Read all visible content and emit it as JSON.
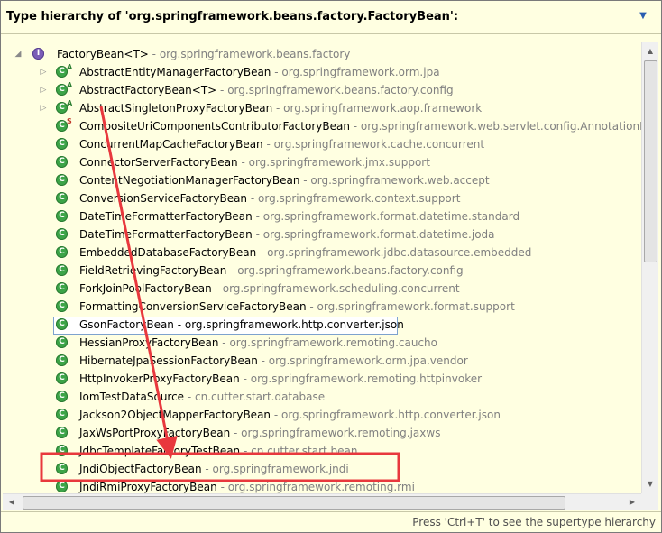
{
  "header": {
    "title": "Type hierarchy of 'org.springframework.beans.factory.FactoryBean':",
    "menu_icon": "view-menu-icon"
  },
  "tree": {
    "root": {
      "name": "FactoryBean<T>",
      "package": " - org.springframework.beans.factory",
      "icon": "interface-icon"
    },
    "items": [
      {
        "name": "AbstractEntityManagerFactoryBean",
        "package": " - org.springframework.orm.jpa",
        "expandable": true,
        "overlay": "A"
      },
      {
        "name": "AbstractFactoryBean<T>",
        "package": " - org.springframework.beans.factory.config",
        "expandable": true,
        "overlay": "A"
      },
      {
        "name": "AbstractSingletonProxyFactoryBean",
        "package": " - org.springframework.aop.framework",
        "expandable": true,
        "overlay": "A"
      },
      {
        "name": "CompositeUriComponentsContributorFactoryBean",
        "package": " - org.springframework.web.servlet.config.AnnotationDriv",
        "expandable": false,
        "overlay": "S"
      },
      {
        "name": "ConcurrentMapCacheFactoryBean",
        "package": " - org.springframework.cache.concurrent",
        "expandable": false,
        "overlay": ""
      },
      {
        "name": "ConnectorServerFactoryBean",
        "package": " - org.springframework.jmx.support",
        "expandable": false,
        "overlay": ""
      },
      {
        "name": "ContentNegotiationManagerFactoryBean",
        "package": " - org.springframework.web.accept",
        "expandable": false,
        "overlay": ""
      },
      {
        "name": "ConversionServiceFactoryBean",
        "package": " - org.springframework.context.support",
        "expandable": false,
        "overlay": ""
      },
      {
        "name": "DateTimeFormatterFactoryBean",
        "package": " - org.springframework.format.datetime.standard",
        "expandable": false,
        "overlay": ""
      },
      {
        "name": "DateTimeFormatterFactoryBean",
        "package": " - org.springframework.format.datetime.joda",
        "expandable": false,
        "overlay": ""
      },
      {
        "name": "EmbeddedDatabaseFactoryBean",
        "package": " - org.springframework.jdbc.datasource.embedded",
        "expandable": false,
        "overlay": ""
      },
      {
        "name": "FieldRetrievingFactoryBean",
        "package": " - org.springframework.beans.factory.config",
        "expandable": false,
        "overlay": ""
      },
      {
        "name": "ForkJoinPoolFactoryBean",
        "package": " - org.springframework.scheduling.concurrent",
        "expandable": false,
        "overlay": ""
      },
      {
        "name": "FormattingConversionServiceFactoryBean",
        "package": " - org.springframework.format.support",
        "expandable": false,
        "overlay": ""
      },
      {
        "name": "GsonFactoryBean",
        "package": " - org.springframework.http.converter.json",
        "expandable": false,
        "overlay": "",
        "selected": true
      },
      {
        "name": "HessianProxyFactoryBean",
        "package": " - org.springframework.remoting.caucho",
        "expandable": false,
        "overlay": ""
      },
      {
        "name": "HibernateJpaSessionFactoryBean",
        "package": " - org.springframework.orm.jpa.vendor",
        "expandable": false,
        "overlay": ""
      },
      {
        "name": "HttpInvokerProxyFactoryBean",
        "package": " - org.springframework.remoting.httpinvoker",
        "expandable": false,
        "overlay": ""
      },
      {
        "name": "IomTestDataSource",
        "package": " - cn.cutter.start.database",
        "expandable": false,
        "overlay": ""
      },
      {
        "name": "Jackson2ObjectMapperFactoryBean",
        "package": " - org.springframework.http.converter.json",
        "expandable": false,
        "overlay": ""
      },
      {
        "name": "JaxWsPortProxyFactoryBean",
        "package": " - org.springframework.remoting.jaxws",
        "expandable": false,
        "overlay": ""
      },
      {
        "name": "JdbcTemplateFactoryTestBean",
        "package": " - cn.cutter.start.bean",
        "expandable": false,
        "overlay": ""
      },
      {
        "name": "JndiObjectFactoryBean",
        "package": " - org.springframework.jndi",
        "expandable": false,
        "overlay": "",
        "highlighted": true
      },
      {
        "name": "JndiRmiProxyFactoryBean",
        "package": " - org.springframework.remoting.rmi",
        "expandable": false,
        "overlay": ""
      }
    ]
  },
  "status_bar": {
    "hint": "Press 'Ctrl+T' to see the supertype hierarchy"
  },
  "annotation": {
    "box_color": "#e8383d",
    "arrow_color": "#e8383d"
  }
}
